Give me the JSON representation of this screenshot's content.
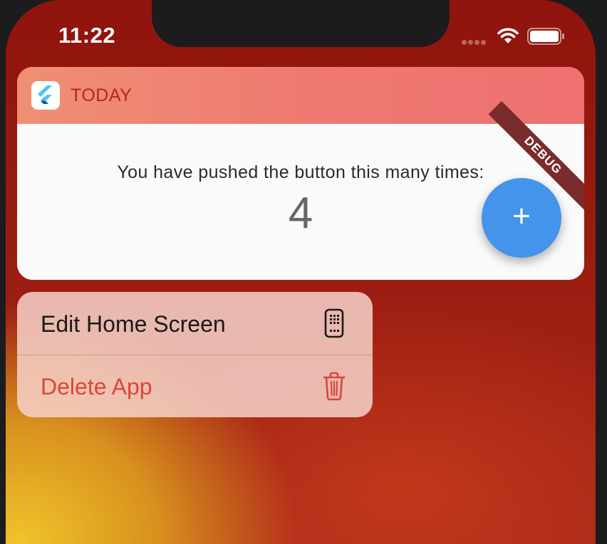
{
  "status_bar": {
    "time": "11:22"
  },
  "widget": {
    "header_title": "TODAY",
    "app_icon": "flutter-logo-icon",
    "counter_label": "You have pushed the button this many times:",
    "counter_value": "4",
    "debug_banner": "DEBUG",
    "fab_label": "+"
  },
  "menu": {
    "items": [
      {
        "label": "Edit Home Screen",
        "icon": "apps-phone-icon"
      },
      {
        "label": "Delete App",
        "icon": "trash-icon"
      }
    ]
  },
  "colors": {
    "header_gradient_start": "#ef8f73",
    "header_gradient_end": "#ee7070",
    "header_text": "#b3261e",
    "fab": "#4394ea",
    "destructive": "#d9473b",
    "debug_banner": "#7a2b2b"
  }
}
